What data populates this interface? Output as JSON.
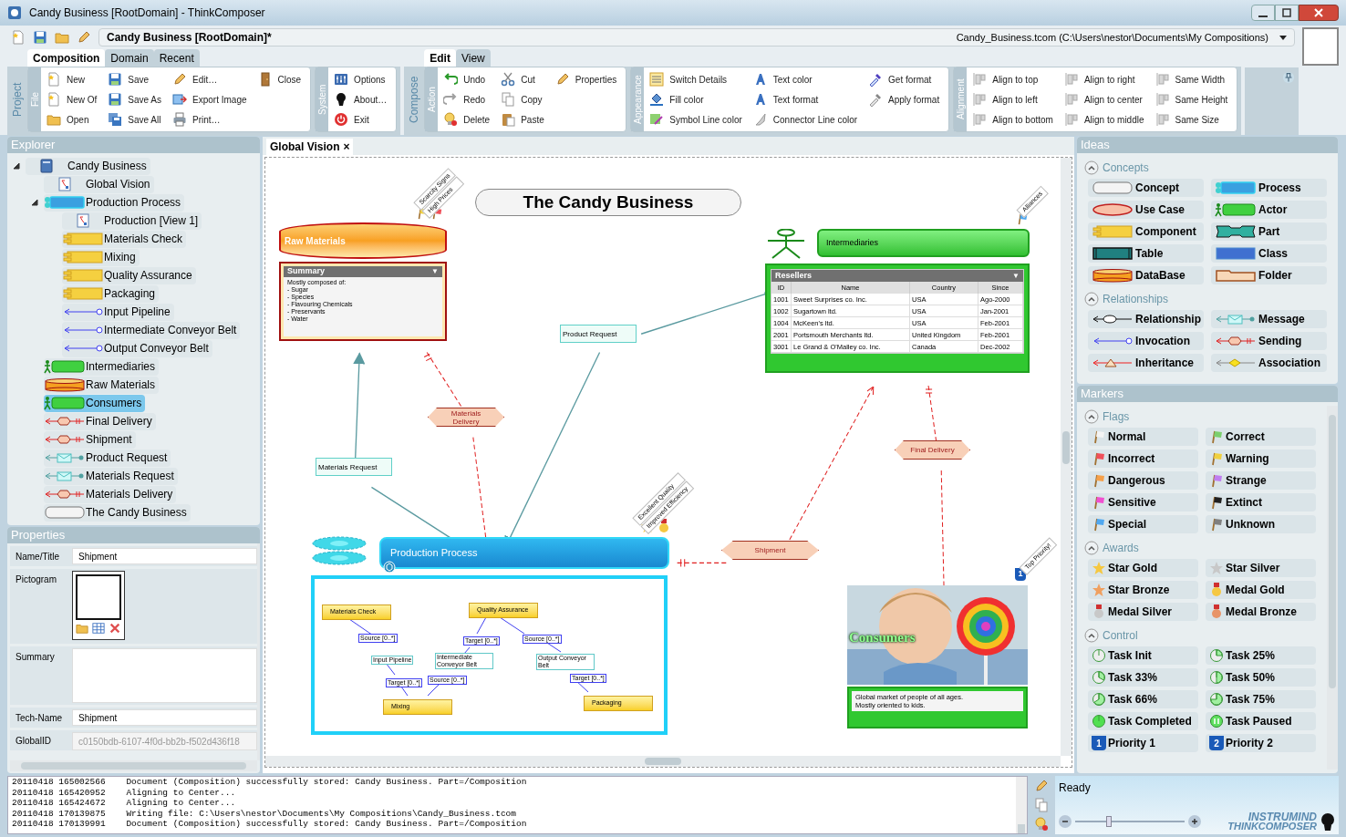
{
  "window": {
    "title": "Candy Business [RootDomain] - ThinkComposer"
  },
  "toolbar": {
    "document_name": "Candy Business [RootDomain]*",
    "file_path": "Candy_Business.tcom (C:\\Users\\nestor\\Documents\\My Compositions)"
  },
  "ribbon": {
    "sections": [
      {
        "side_label": "Project",
        "tabs": [
          {
            "label": "Composition",
            "selected": true
          },
          {
            "label": "Domain",
            "selected": false
          },
          {
            "label": "Recent",
            "selected": false
          }
        ],
        "groups": [
          {
            "title": "File",
            "columns": [
              [
                "New",
                "New Of",
                "Open"
              ],
              [
                "Save",
                "Save As",
                "Save All"
              ],
              [
                "Edit…",
                "Export Image",
                "Print…"
              ],
              [
                "Close"
              ]
            ]
          },
          {
            "title": "System",
            "columns": [
              [
                "Options",
                "About…",
                "Exit"
              ]
            ]
          }
        ]
      },
      {
        "side_label": "Compose",
        "tabs": [
          {
            "label": "Edit",
            "selected": true
          },
          {
            "label": "View",
            "selected": false
          }
        ],
        "groups": [
          {
            "title": "Action",
            "columns": [
              [
                "Undo",
                "Redo",
                "Delete"
              ],
              [
                "Cut",
                "Copy",
                "Paste"
              ],
              [
                "Properties"
              ]
            ]
          },
          {
            "title": "Appearance",
            "columns": [
              [
                "Switch Details",
                "Fill color",
                "Symbol Line color"
              ],
              [
                "Text color",
                "Text format",
                "Connector Line color"
              ],
              [
                "Get format",
                "Apply format"
              ]
            ]
          },
          {
            "title": "Alignment",
            "columns": [
              [
                "Align to top",
                "Align to left",
                "Align to bottom"
              ],
              [
                "Align to right",
                "Align to center",
                "Align to middle"
              ],
              [
                "Same Width",
                "Same Height",
                "Same Size"
              ]
            ]
          }
        ]
      }
    ]
  },
  "explorer": {
    "title": "Explorer",
    "items": [
      {
        "label": "Candy Business",
        "kind": "document",
        "selected": false,
        "expanded": true,
        "children": [
          {
            "label": "Global Vision",
            "kind": "view",
            "selected": false
          },
          {
            "label": "Production Process",
            "kind": "process",
            "selected": false,
            "expanded": true,
            "children": [
              {
                "label": "Production [View 1]",
                "kind": "view",
                "selected": false
              },
              {
                "label": "Materials Check",
                "kind": "component",
                "selected": false
              },
              {
                "label": "Mixing",
                "kind": "component",
                "selected": false
              },
              {
                "label": "Quality Assurance",
                "kind": "component",
                "selected": false
              },
              {
                "label": "Packaging",
                "kind": "component",
                "selected": false
              },
              {
                "label": "Input Pipeline",
                "kind": "pipe",
                "selected": false
              },
              {
                "label": "Intermediate Conveyor Belt",
                "kind": "pipe",
                "selected": false
              },
              {
                "label": "Output Conveyor Belt",
                "kind": "pipe",
                "selected": false
              }
            ]
          },
          {
            "label": "Intermediaries",
            "kind": "actor",
            "selected": false
          },
          {
            "label": "Raw Materials",
            "kind": "database",
            "selected": false
          },
          {
            "label": "Consumers",
            "kind": "actor",
            "selected": true
          },
          {
            "label": "Final Delivery",
            "kind": "sending",
            "selected": false
          },
          {
            "label": "Shipment",
            "kind": "sending",
            "selected": false
          },
          {
            "label": "Product Request",
            "kind": "message",
            "selected": false
          },
          {
            "label": "Materials Request",
            "kind": "message",
            "selected": false
          },
          {
            "label": "Materials Delivery",
            "kind": "sending",
            "selected": false
          },
          {
            "label": "The Candy Business",
            "kind": "concept",
            "selected": false
          }
        ]
      }
    ]
  },
  "properties": {
    "title": "Properties",
    "fields": [
      {
        "label": "Name/Title",
        "kind": "text",
        "value": "Shipment"
      },
      {
        "label": "Pictogram",
        "kind": "pictogram"
      },
      {
        "label": "Summary",
        "kind": "textarea"
      },
      {
        "label": "Tech-Name",
        "kind": "text",
        "value": "Shipment"
      },
      {
        "label": "GlobalID",
        "kind": "readonly",
        "value": "c0150bdb-6107-4f0d-bb2b-f502d436f18",
        "disabled": true
      }
    ]
  },
  "document_tabs": [
    {
      "label": "Global Vision",
      "close": "×",
      "selected": true
    }
  ],
  "diagram": {
    "title": "The Candy Business",
    "raw_materials": {
      "label": "Raw Materials",
      "tags": [
        "Scarcity Signs",
        "High Prices"
      ],
      "detail_title": "Summary",
      "detail_toggle": "▼",
      "detail_lines": [
        "Mostly composed of:",
        "- Sugar",
        "- Species",
        "- Flavouring Chemicals",
        "- Preservants",
        "- Water"
      ]
    },
    "intermediaries": {
      "label": "Intermediaries",
      "tags": [
        "Alliances"
      ],
      "table": {
        "title": "Resellers",
        "toggle": "▼",
        "columns": [
          "ID",
          "Name",
          "Country",
          "Since"
        ],
        "rows": [
          [
            "1001",
            "Sweet Surprises co. Inc.",
            "USA",
            "Ago-2000"
          ],
          [
            "1002",
            "Sugartown ltd.",
            "USA",
            "Jan-2001"
          ],
          [
            "1004",
            "McKeen's ltd.",
            "USA",
            "Feb-2001"
          ],
          [
            "2001",
            "Portsmouth Merchants ltd.",
            "United Kingdom",
            "Feb-2001"
          ],
          [
            "3001",
            "Le Grand & O'Malley co. Inc.",
            "Canada",
            "Dec-2002"
          ]
        ]
      }
    },
    "production": {
      "label": "Production Process",
      "tags": [
        "Excellent Quality",
        "Improved Efficiency"
      ],
      "components": [
        "Materials Check",
        "Quality Assurance",
        "Mixing",
        "Packaging"
      ],
      "links": [
        "Source [0..*]",
        "Input Pipeline",
        "Target [0..*]",
        "Target [0..*]",
        "Intermediate Conveyor Belt",
        "Source [0..*]",
        "Source [0..*]",
        "Output Conveyor Belt",
        "Target [0..*]"
      ]
    },
    "consumers": {
      "label": "Consumers",
      "tags": [
        "Top Priority!"
      ],
      "priority": "1",
      "note_lines": [
        "Global market of people of all ages.",
        "Mostly oriented to kids."
      ]
    },
    "connectors": [
      {
        "label": "Materials Delivery",
        "kind": "sending"
      },
      {
        "label": "Product Request",
        "kind": "message"
      },
      {
        "label": "Materials Request",
        "kind": "message"
      },
      {
        "label": "Final Delivery",
        "kind": "sending"
      },
      {
        "label": "Shipment",
        "kind": "sending"
      }
    ]
  },
  "ideas": {
    "title": "Ideas",
    "sections": [
      {
        "title": "Concepts",
        "expanded": true,
        "items": [
          {
            "label": "Concept",
            "kind": "concept"
          },
          {
            "label": "Process",
            "kind": "process"
          },
          {
            "label": "Use Case",
            "kind": "usecase"
          },
          {
            "label": "Actor",
            "kind": "actor"
          },
          {
            "label": "Component",
            "kind": "component"
          },
          {
            "label": "Part",
            "kind": "part"
          },
          {
            "label": "Table",
            "kind": "table"
          },
          {
            "label": "Class",
            "kind": "class"
          },
          {
            "label": "DataBase",
            "kind": "database"
          },
          {
            "label": "Folder",
            "kind": "folder"
          }
        ]
      },
      {
        "title": "Relationships",
        "expanded": true,
        "items": [
          {
            "label": "Relationship",
            "kind": "relationship"
          },
          {
            "label": "Message",
            "kind": "message"
          },
          {
            "label": "Invocation",
            "kind": "invocation"
          },
          {
            "label": "Sending",
            "kind": "sending"
          },
          {
            "label": "Inheritance",
            "kind": "inheritance"
          },
          {
            "label": "Association",
            "kind": "association"
          }
        ]
      }
    ]
  },
  "markers": {
    "title": "Markers",
    "sections": [
      {
        "title": "Flags",
        "expanded": true,
        "items": [
          {
            "label": "Normal",
            "kind": "flag",
            "color": "#f4f4f4"
          },
          {
            "label": "Correct",
            "kind": "flag",
            "color": "#7ccf6e"
          },
          {
            "label": "Incorrect",
            "kind": "flag",
            "color": "#f0505a"
          },
          {
            "label": "Warning",
            "kind": "flag",
            "color": "#f0d040"
          },
          {
            "label": "Dangerous",
            "kind": "flag",
            "color": "#f5a04a"
          },
          {
            "label": "Strange",
            "kind": "flag",
            "color": "#c07ef0"
          },
          {
            "label": "Sensitive",
            "kind": "flag",
            "color": "#f050d0"
          },
          {
            "label": "Extinct",
            "kind": "flag",
            "color": "#202020"
          },
          {
            "label": "Special",
            "kind": "flag",
            "color": "#50a8f0"
          },
          {
            "label": "Unknown",
            "kind": "flag",
            "color": "#808080"
          }
        ]
      },
      {
        "title": "Awards",
        "expanded": true,
        "items": [
          {
            "label": "Star Gold",
            "kind": "star",
            "color": "#f5c842"
          },
          {
            "label": "Star Silver",
            "kind": "star",
            "color": "#c8c8c8"
          },
          {
            "label": "Star Bronze",
            "kind": "star",
            "color": "#f0a060"
          },
          {
            "label": "Medal Gold",
            "kind": "medal",
            "color": "#f5c842"
          },
          {
            "label": "Medal Silver",
            "kind": "medal",
            "color": "#c8c8c8"
          },
          {
            "label": "Medal Bronze",
            "kind": "medal",
            "color": "#e89468"
          }
        ]
      },
      {
        "title": "Control",
        "expanded": true,
        "items": [
          {
            "label": "Task Init",
            "kind": "init"
          },
          {
            "label": "Task 25%",
            "kind": "quarter"
          },
          {
            "label": "Task 33%",
            "kind": "third"
          },
          {
            "label": "Task 50%",
            "kind": "half"
          },
          {
            "label": "Task 66%",
            "kind": "twothirds"
          },
          {
            "label": "Task 75%",
            "kind": "threequarters"
          },
          {
            "label": "Task Completed",
            "kind": "completed"
          },
          {
            "label": "Task Paused",
            "kind": "paused"
          },
          {
            "label": "Priority 1",
            "kind": "priority",
            "badge": "1"
          },
          {
            "label": "Priority 2",
            "kind": "priority",
            "badge": "2"
          }
        ]
      }
    ]
  },
  "log": [
    "20110418 165002566    Document (Composition) successfully stored: Candy Business. Part=/Composition",
    "20110418 165420952    Aligning to Center...",
    "20110418 165424672    Aligning to Center...",
    "20110418 170139875    Writing file: C:\\Users\\nestor\\Documents\\My Compositions\\Candy_Business.tcom",
    "20110418 170139991    Document (Composition) successfully stored: Candy Business. Part=/Composition"
  ],
  "status": {
    "message": "Ready",
    "zoom": {
      "level": 0.3
    },
    "logo": [
      "INSTRUMIND",
      "THINKCOMPOSER"
    ]
  }
}
